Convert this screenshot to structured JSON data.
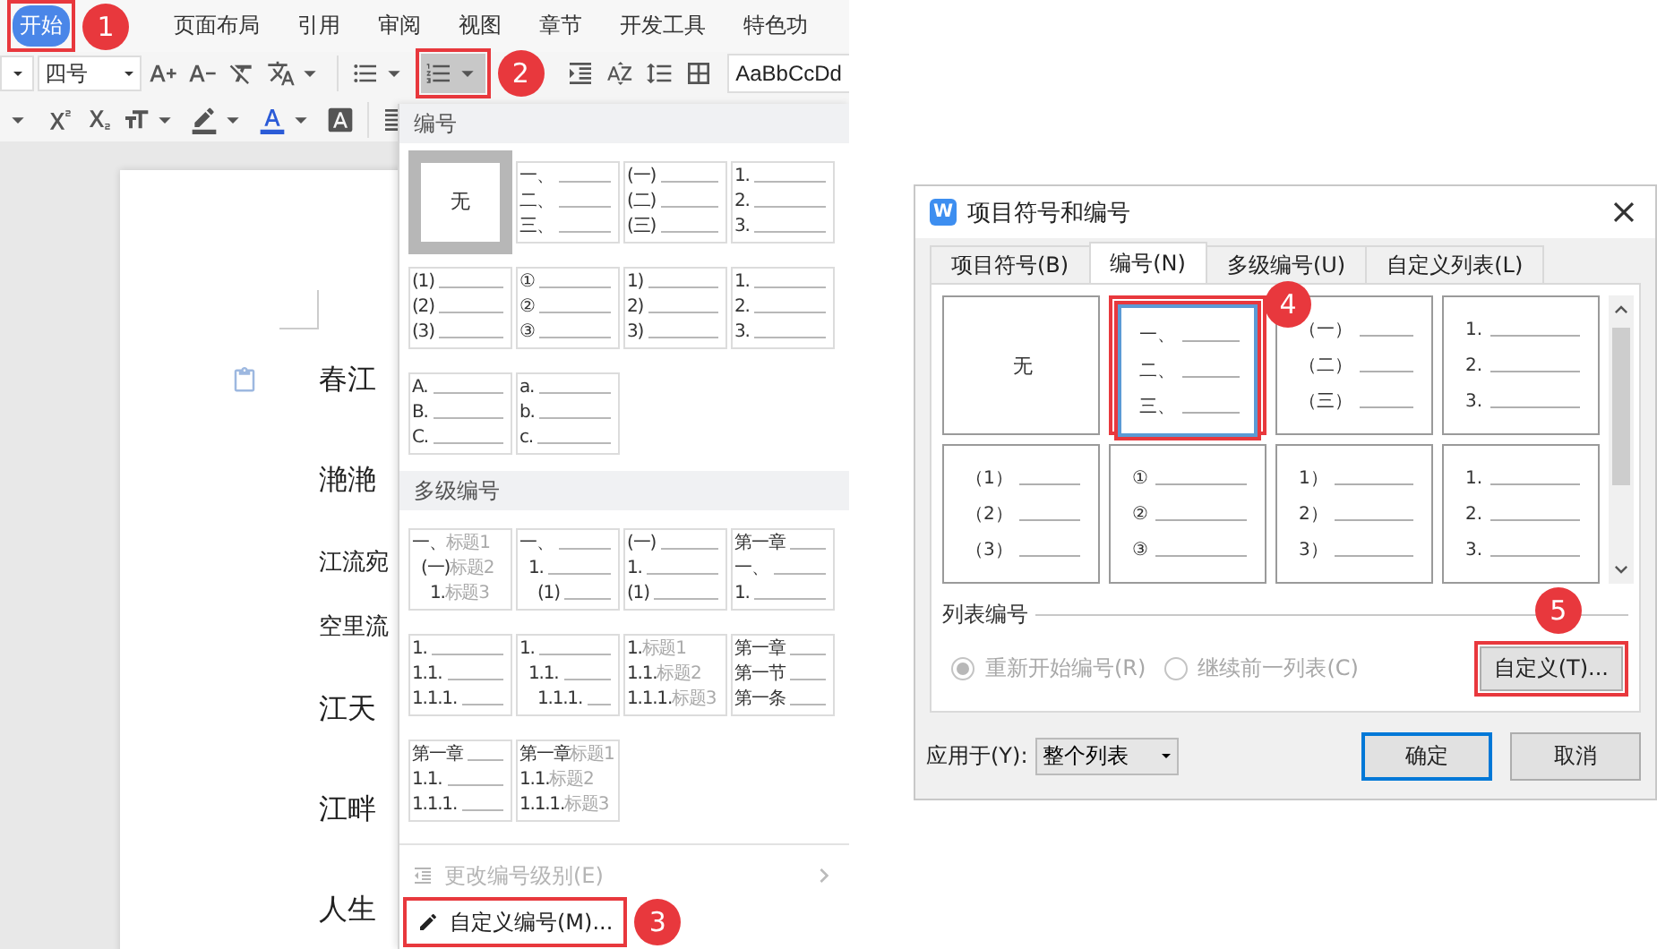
{
  "ribbon_tabs": [
    {
      "label": "开始",
      "selected": true,
      "highlighted": true,
      "callout": "1"
    },
    {
      "label": "页面布局",
      "selected": false,
      "highlighted": false
    },
    {
      "label": "引用",
      "selected": false,
      "highlighted": false
    },
    {
      "label": "审阅",
      "selected": false,
      "highlighted": false
    },
    {
      "label": "视图",
      "selected": false,
      "highlighted": false
    },
    {
      "label": "章节",
      "selected": false,
      "highlighted": false
    },
    {
      "label": "开发工具",
      "selected": false,
      "highlighted": false
    },
    {
      "label": "特色功",
      "selected": false,
      "highlighted": false
    }
  ],
  "toolbar": {
    "font_size": "四号",
    "style_preview": "AaBbCcDd",
    "numbering_button": {
      "active": true,
      "highlighted": true,
      "callout": "2"
    }
  },
  "document": {
    "lines": [
      {
        "text": "春江",
        "kind": "large"
      },
      {
        "text": "滟滟",
        "kind": "large"
      },
      {
        "text": "江流宛",
        "kind": "small"
      },
      {
        "text": "空里流",
        "kind": "small"
      },
      {
        "text": "江天",
        "kind": "large"
      },
      {
        "text": "江畔",
        "kind": "large"
      },
      {
        "text": "人生",
        "kind": "large"
      }
    ]
  },
  "numbering_menu": {
    "numbering_title": "编号",
    "numbering_styles": [
      {
        "kind": "none",
        "label": "无",
        "selected": true
      },
      {
        "kind": "list",
        "selected": false,
        "lines": [
          {
            "label": "一、"
          },
          {
            "label": "二、"
          },
          {
            "label": "三、"
          }
        ]
      },
      {
        "kind": "list",
        "selected": false,
        "lines": [
          {
            "label": "(一)"
          },
          {
            "label": "(二)"
          },
          {
            "label": "(三)"
          }
        ]
      },
      {
        "kind": "list",
        "selected": false,
        "lines": [
          {
            "label": "1."
          },
          {
            "label": "2."
          },
          {
            "label": "3."
          }
        ]
      },
      {
        "kind": "list",
        "selected": false,
        "lines": [
          {
            "label": "(1)"
          },
          {
            "label": "(2)"
          },
          {
            "label": "(3)"
          }
        ]
      },
      {
        "kind": "list",
        "selected": false,
        "lines": [
          {
            "label": "①"
          },
          {
            "label": "②"
          },
          {
            "label": "③"
          }
        ]
      },
      {
        "kind": "list",
        "selected": false,
        "lines": [
          {
            "label": "1)"
          },
          {
            "label": "2)"
          },
          {
            "label": "3)"
          }
        ]
      },
      {
        "kind": "list",
        "selected": false,
        "lines": [
          {
            "label": "1."
          },
          {
            "label": "2."
          },
          {
            "label": "3."
          }
        ]
      },
      {
        "kind": "list",
        "selected": false,
        "lines": [
          {
            "label": "A."
          },
          {
            "label": "B."
          },
          {
            "label": "C."
          }
        ]
      },
      {
        "kind": "list",
        "selected": false,
        "lines": [
          {
            "label": "a."
          },
          {
            "label": "b."
          },
          {
            "label": "c."
          }
        ]
      }
    ],
    "multilevel_title": "多级编号",
    "multilevel_styles": [
      {
        "kind": "list",
        "selected": false,
        "indented": true,
        "lines": [
          {
            "label": "一、",
            "caption": "标题1"
          },
          {
            "label": "(一)",
            "caption": "标题2"
          },
          {
            "label": "1.",
            "caption": "标题3"
          }
        ]
      },
      {
        "kind": "list",
        "selected": false,
        "indented": true,
        "lines": [
          {
            "label": "一、"
          },
          {
            "label": "1."
          },
          {
            "label": "(1)"
          }
        ]
      },
      {
        "kind": "list",
        "selected": false,
        "indented": false,
        "lines": [
          {
            "label": "(一)"
          },
          {
            "label": "1."
          },
          {
            "label": "(1)"
          }
        ]
      },
      {
        "kind": "list",
        "selected": false,
        "indented": false,
        "lines": [
          {
            "label": "第一章"
          },
          {
            "label": "一、"
          },
          {
            "label": "1."
          }
        ]
      },
      {
        "kind": "list",
        "selected": false,
        "indented": false,
        "lines": [
          {
            "label": "1."
          },
          {
            "label": "1.1."
          },
          {
            "label": "1.1.1."
          }
        ]
      },
      {
        "kind": "list",
        "selected": false,
        "indented": true,
        "lines": [
          {
            "label": "1."
          },
          {
            "label": "1.1."
          },
          {
            "label": "1.1.1."
          }
        ]
      },
      {
        "kind": "list",
        "selected": false,
        "indented": false,
        "lines": [
          {
            "label": "1.",
            "caption": "标题1"
          },
          {
            "label": "1.1.",
            "caption": "标题2"
          },
          {
            "label": "1.1.1.",
            "caption": "标题3"
          }
        ]
      },
      {
        "kind": "list",
        "selected": false,
        "indented": false,
        "lines": [
          {
            "label": "第一章"
          },
          {
            "label": "第一节"
          },
          {
            "label": "第一条"
          }
        ]
      },
      {
        "kind": "list",
        "selected": false,
        "indented": false,
        "lines": [
          {
            "label": "第一章"
          },
          {
            "label": "1.1."
          },
          {
            "label": "1.1.1."
          }
        ]
      },
      {
        "kind": "list",
        "selected": false,
        "indented": false,
        "lines": [
          {
            "label": "第一章",
            "caption": "标题1"
          },
          {
            "label": "1.1.",
            "caption": "标题2"
          },
          {
            "label": "1.1.1.",
            "caption": "标题3"
          }
        ]
      }
    ],
    "items": [
      {
        "label": "更改编号级别(E)",
        "kind": "level",
        "disabled": true,
        "submenu": true,
        "highlighted": false
      },
      {
        "label": "自定义编号(M)...",
        "kind": "edit",
        "disabled": false,
        "submenu": false,
        "highlighted": true,
        "callout": "3"
      }
    ]
  },
  "dialog": {
    "icon_letter": "W",
    "title": "项目符号和编号",
    "tabs": [
      {
        "label": "项目符号(B)",
        "selected": false
      },
      {
        "label": "编号(N)",
        "selected": true
      },
      {
        "label": "多级编号(U)",
        "selected": false
      },
      {
        "label": "自定义列表(L)",
        "selected": false
      }
    ],
    "styles": [
      {
        "kind": "none",
        "label": "无",
        "selected": false,
        "highlighted": false
      },
      {
        "kind": "list",
        "selected": true,
        "highlighted": true,
        "callout": "4",
        "lines": [
          {
            "label": "一、"
          },
          {
            "label": "二、"
          },
          {
            "label": "三、"
          }
        ]
      },
      {
        "kind": "list",
        "selected": false,
        "highlighted": false,
        "lines": [
          {
            "label": "（一）"
          },
          {
            "label": "（二）"
          },
          {
            "label": "（三）"
          }
        ]
      },
      {
        "kind": "list",
        "selected": false,
        "highlighted": false,
        "lines": [
          {
            "label": "1."
          },
          {
            "label": "2."
          },
          {
            "label": "3."
          }
        ]
      },
      {
        "kind": "list",
        "selected": false,
        "highlighted": false,
        "lines": [
          {
            "label": "（1）"
          },
          {
            "label": "（2）"
          },
          {
            "label": "（3）"
          }
        ]
      },
      {
        "kind": "list",
        "selected": false,
        "highlighted": false,
        "lines": [
          {
            "label": "①"
          },
          {
            "label": "②"
          },
          {
            "label": "③"
          }
        ]
      },
      {
        "kind": "list",
        "selected": false,
        "highlighted": false,
        "lines": [
          {
            "label": "1）"
          },
          {
            "label": "2）"
          },
          {
            "label": "3）"
          }
        ]
      },
      {
        "kind": "list",
        "selected": false,
        "highlighted": false,
        "lines": [
          {
            "label": "1."
          },
          {
            "label": "2."
          },
          {
            "label": "3."
          }
        ]
      }
    ],
    "list_numbering": {
      "title": "列表编号",
      "disabled": true,
      "options": [
        {
          "label": "重新开始编号(R)",
          "selected": true
        },
        {
          "label": "继续前一列表(C)",
          "selected": false
        }
      ],
      "custom_button": {
        "label": "自定义(T)...",
        "highlighted": true,
        "callout": "5"
      }
    },
    "apply_to": {
      "label": "应用于(Y):",
      "value": "整个列表"
    },
    "buttons": [
      {
        "label": "确定",
        "default": true
      },
      {
        "label": "取消",
        "default": false
      }
    ]
  }
}
